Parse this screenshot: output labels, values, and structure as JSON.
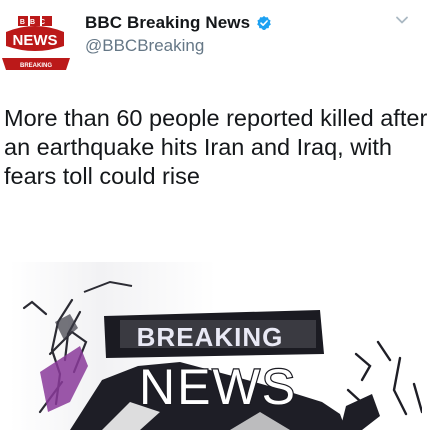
{
  "account": {
    "display_name": "BBC Breaking News",
    "handle": "@BBCBreaking",
    "avatar_text": {
      "logo": "BBC",
      "news": "NEWS",
      "breaking": "BREAKING"
    }
  },
  "tweet": {
    "text": "More than 60 people reported killed after an earthquake hits Iran and Iraq, with fears toll could rise"
  },
  "media": {
    "line1": "BREAKING",
    "line2": "NEWS"
  },
  "colors": {
    "accent": "#1da1f2",
    "bbc_red": "#bb1919",
    "text": "#14171a",
    "secondary": "#657786"
  },
  "icons": [
    "verified-badge-icon",
    "chevron-down-icon"
  ]
}
